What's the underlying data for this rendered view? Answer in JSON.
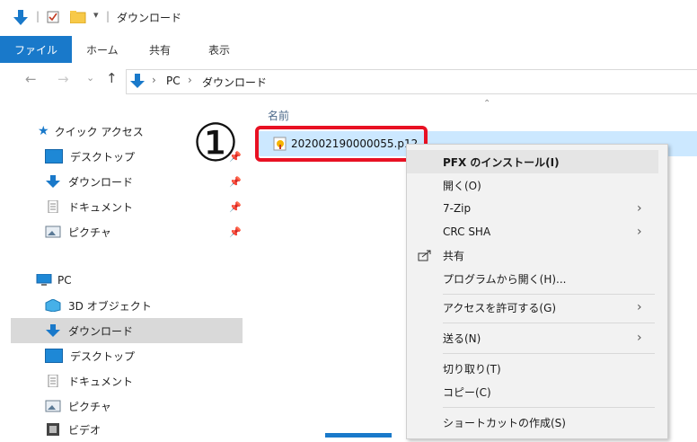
{
  "window": {
    "title": "ダウンロード",
    "title_separator": "|"
  },
  "ribbon": {
    "tabs": [
      "ファイル",
      "ホーム",
      "共有",
      "表示"
    ],
    "expand_icon": "chevron-down-icon"
  },
  "address": {
    "path": [
      "PC",
      "ダウンロード"
    ],
    "separator": "›"
  },
  "sidebar": {
    "quick_access_label": "クイック アクセス",
    "quick_access_items": [
      "デスクトップ",
      "ダウンロード",
      "ドキュメント",
      "ピクチャ"
    ],
    "pc_label": "PC",
    "pc_items": [
      "3D オブジェクト",
      "ダウンロード",
      "デスクトップ",
      "ドキュメント",
      "ピクチャ",
      "ビデオ"
    ],
    "selected_item": "ダウンロード"
  },
  "content": {
    "column_header": "名前",
    "file_name": "202002190000055.p12",
    "annotation_number": "①"
  },
  "context_menu": {
    "items": [
      {
        "label": "PFX のインストール(I)",
        "bold": true
      },
      {
        "label": "開く(O)"
      },
      {
        "label": "7-Zip",
        "submenu": true
      },
      {
        "label": "CRC SHA",
        "submenu": true
      },
      {
        "label": "共有",
        "icon": "share-icon"
      },
      {
        "label": "プログラムから開く(H)..."
      },
      {
        "label": "アクセスを許可する(G)",
        "submenu": true
      },
      {
        "label": "送る(N)",
        "submenu": true
      },
      {
        "label": "切り取り(T)"
      },
      {
        "label": "コピー(C)"
      },
      {
        "label": "ショートカットの作成(S)"
      }
    ],
    "submenu_glyph": "›"
  },
  "colors": {
    "accent": "#1979ca",
    "highlight": "#e81123",
    "selection": "#cce8ff",
    "menu_hover": "#e5e5e5"
  }
}
